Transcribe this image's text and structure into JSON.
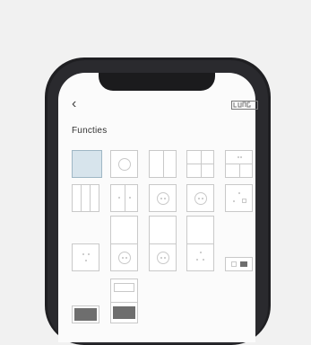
{
  "app": {
    "brand": "JUNG",
    "back_glyph": "‹",
    "title": "Functies"
  },
  "grid": {
    "tiles": [
      {
        "name": "blank-frame",
        "selected": true
      },
      {
        "name": "round-switch"
      },
      {
        "name": "two-rocker"
      },
      {
        "name": "four-rocker"
      },
      {
        "name": "split-rocker-label"
      },
      {
        "name": "three-rocker"
      },
      {
        "name": "four-rocker-arrows"
      },
      {
        "name": "socket-outlet"
      },
      {
        "name": "socket-outlet-alt"
      },
      {
        "name": "socket-usb"
      },
      {
        "name": "socket-outlet-small"
      },
      {
        "name": "tall-socket-1"
      },
      {
        "name": "tall-socket-2"
      },
      {
        "name": "tall-socket-usb"
      },
      {
        "name": "dimmer-small"
      },
      {
        "name": "dark-module-1"
      },
      {
        "name": "dark-module-2"
      }
    ]
  },
  "colors": {
    "accent_selected": "#d7e4ec",
    "tile_border": "#c9c9c9",
    "dark_module": "#6e6e6e"
  }
}
